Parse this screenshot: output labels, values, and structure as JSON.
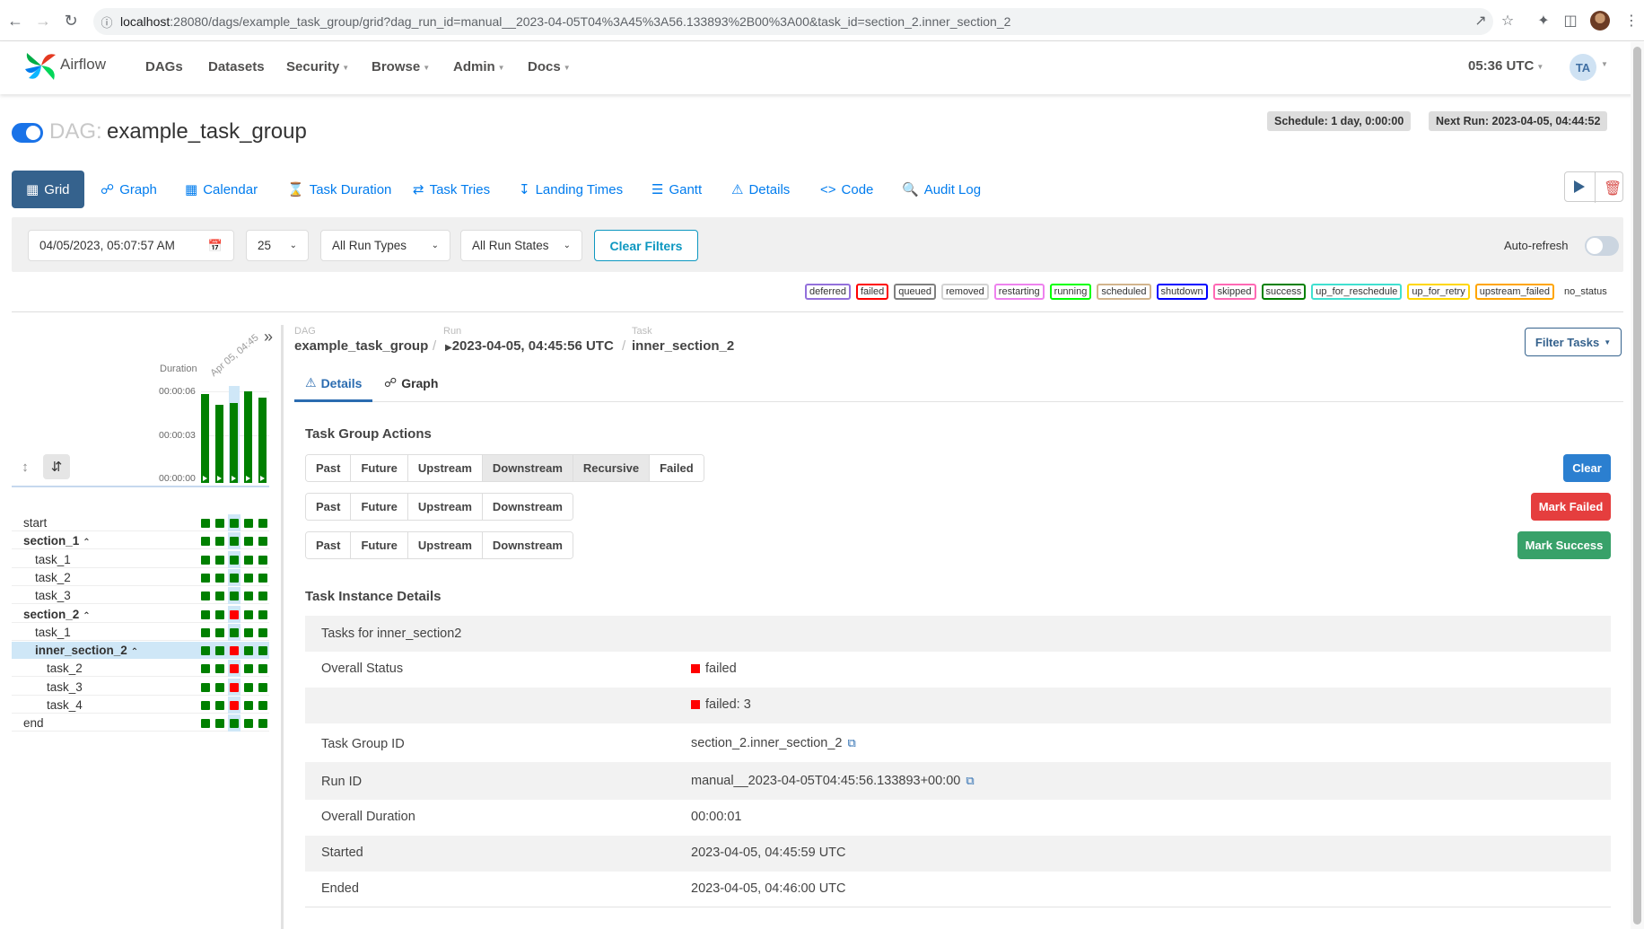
{
  "browser": {
    "url_host": "localhost",
    "url_rest": ":28080/dags/example_task_group/grid?dag_run_id=manual__2023-04-05T04%3A45%3A56.133893%2B00%3A00&task_id=section_2.inner_section_2"
  },
  "navbar": {
    "brand": "Airflow",
    "items": [
      "DAGs",
      "Datasets",
      "Security",
      "Browse",
      "Admin",
      "Docs"
    ],
    "time": "05:36 UTC",
    "user_initials": "TA"
  },
  "dag": {
    "prefix": "DAG:",
    "name": "example_task_group",
    "schedule": "Schedule: 1 day, 0:00:00",
    "next_run": "Next Run: 2023-04-05, 04:44:52"
  },
  "tabs": [
    {
      "label": "Grid",
      "icon": "grid-icon"
    },
    {
      "label": "Graph",
      "icon": "graph-icon"
    },
    {
      "label": "Calendar",
      "icon": "calendar-icon"
    },
    {
      "label": "Task Duration",
      "icon": "hourglass-icon"
    },
    {
      "label": "Task Tries",
      "icon": "repeat-icon"
    },
    {
      "label": "Landing Times",
      "icon": "landing-icon"
    },
    {
      "label": "Gantt",
      "icon": "gantt-icon"
    },
    {
      "label": "Details",
      "icon": "warning-icon"
    },
    {
      "label": "Code",
      "icon": "code-icon"
    },
    {
      "label": "Audit Log",
      "icon": "search-doc-icon"
    }
  ],
  "filters": {
    "date": "04/05/2023, 05:07:57 AM",
    "num_runs": "25",
    "run_types": "All Run Types",
    "run_states": "All Run States",
    "clear_label": "Clear Filters",
    "auto_refresh": "Auto-refresh"
  },
  "legend": [
    {
      "label": "deferred",
      "color": "#9370db"
    },
    {
      "label": "failed",
      "color": "#ff0000"
    },
    {
      "label": "queued",
      "color": "#808080"
    },
    {
      "label": "removed",
      "color": "#d3d3d3"
    },
    {
      "label": "restarting",
      "color": "#ee82ee"
    },
    {
      "label": "running",
      "color": "#00ff00"
    },
    {
      "label": "scheduled",
      "color": "#d2b48c"
    },
    {
      "label": "shutdown",
      "color": "#0000ff"
    },
    {
      "label": "skipped",
      "color": "#ff69b4"
    },
    {
      "label": "success",
      "color": "#008000"
    },
    {
      "label": "up_for_reschedule",
      "color": "#40e0d0"
    },
    {
      "label": "up_for_retry",
      "color": "#ffd700"
    },
    {
      "label": "upstream_failed",
      "color": "#ffa500"
    },
    {
      "label": "no_status",
      "color": ""
    }
  ],
  "grid": {
    "duration_label": "Duration",
    "run_date_label": "Apr 05, 04:45",
    "yticks": [
      "00:00:06",
      "00:00:03",
      "00:00:00"
    ],
    "run_durations": [
      6.1,
      5.4,
      5.5,
      6.3,
      5.9
    ],
    "selected_run": 2,
    "rows": [
      {
        "name": "start",
        "level": 0,
        "group": false,
        "states": [
          "s",
          "s",
          "s",
          "s",
          "s"
        ]
      },
      {
        "name": "section_1",
        "level": 0,
        "group": true,
        "states": [
          "s",
          "s",
          "s",
          "s",
          "s"
        ]
      },
      {
        "name": "task_1",
        "level": 1,
        "group": false,
        "states": [
          "s",
          "s",
          "s",
          "s",
          "s"
        ]
      },
      {
        "name": "task_2",
        "level": 1,
        "group": false,
        "states": [
          "s",
          "s",
          "s",
          "s",
          "s"
        ]
      },
      {
        "name": "task_3",
        "level": 1,
        "group": false,
        "states": [
          "s",
          "s",
          "s",
          "s",
          "s"
        ]
      },
      {
        "name": "section_2",
        "level": 0,
        "group": true,
        "states": [
          "s",
          "s",
          "f",
          "s",
          "s"
        ]
      },
      {
        "name": "task_1",
        "level": 1,
        "group": false,
        "states": [
          "s",
          "s",
          "s",
          "s",
          "s"
        ]
      },
      {
        "name": "inner_section_2",
        "level": 1,
        "group": true,
        "selected": true,
        "states": [
          "s",
          "s",
          "f",
          "s",
          "s"
        ]
      },
      {
        "name": "task_2",
        "level": 2,
        "group": false,
        "states": [
          "s",
          "s",
          "f",
          "s",
          "s"
        ]
      },
      {
        "name": "task_3",
        "level": 2,
        "group": false,
        "states": [
          "s",
          "s",
          "f",
          "s",
          "s"
        ]
      },
      {
        "name": "task_4",
        "level": 2,
        "group": false,
        "states": [
          "s",
          "s",
          "f",
          "s",
          "s"
        ]
      },
      {
        "name": "end",
        "level": 0,
        "group": false,
        "states": [
          "s",
          "s",
          "s",
          "s",
          "s"
        ]
      }
    ]
  },
  "breadcrumb": {
    "dag_label": "DAG",
    "dag_value": "example_task_group",
    "run_label": "Run",
    "run_value": "2023-04-05, 04:45:56 UTC",
    "task_label": "Task",
    "task_value": "inner_section_2",
    "filter_tasks": "Filter Tasks"
  },
  "detail_tabs": [
    "Details",
    "Graph"
  ],
  "actions": {
    "title": "Task Group Actions",
    "row1": [
      "Past",
      "Future",
      "Upstream",
      "Downstream",
      "Recursive",
      "Failed"
    ],
    "row2": [
      "Past",
      "Future",
      "Upstream",
      "Downstream"
    ],
    "row3": [
      "Past",
      "Future",
      "Upstream",
      "Downstream"
    ],
    "clear": "Clear",
    "mark_failed": "Mark Failed",
    "mark_success": "Mark Success"
  },
  "details": {
    "title": "Task Instance Details",
    "header": "Tasks for inner_section2",
    "overall_status_key": "Overall Status",
    "overall_status_val": "failed",
    "failed_count": "failed: 3",
    "task_group_id_key": "Task Group ID",
    "task_group_id_val": "section_2.inner_section_2",
    "run_id_key": "Run ID",
    "run_id_val": "manual__2023-04-05T04:45:56.133893+00:00",
    "duration_key": "Overall Duration",
    "duration_val": "00:00:01",
    "started_key": "Started",
    "started_val": "2023-04-05, 04:45:59 UTC",
    "ended_key": "Ended",
    "ended_val": "2023-04-05, 04:46:00 UTC"
  }
}
